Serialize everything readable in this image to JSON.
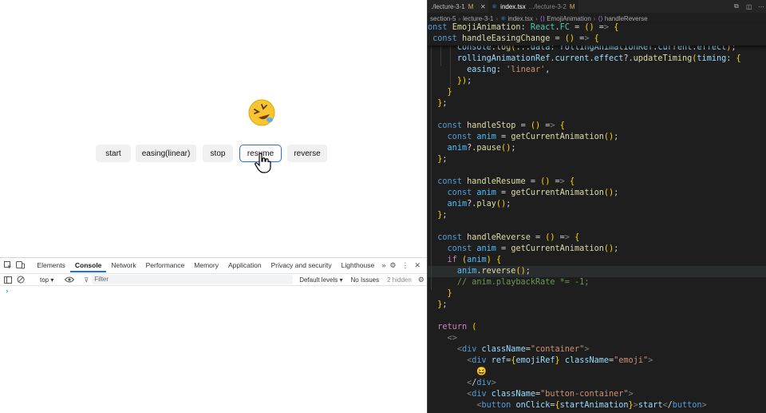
{
  "demo": {
    "buttons": [
      {
        "label": "start"
      },
      {
        "label": "easing(linear)"
      },
      {
        "label": "stop"
      },
      {
        "label": "resume",
        "active": true
      },
      {
        "label": "reverse"
      }
    ]
  },
  "devtools": {
    "tabs": [
      "Elements",
      "Console",
      "Network",
      "Performance",
      "Memory",
      "Application",
      "Privacy and security",
      "Lighthouse"
    ],
    "selected_tab": "Console",
    "context": "top",
    "filter_placeholder": "Filter",
    "levels": "Default levels",
    "issues": "No Issues",
    "hidden": "2 hidden",
    "prompt": "›"
  },
  "editor": {
    "tabs": [
      {
        "name": "./lecture-3-1",
        "status": "M"
      },
      {
        "name": "index.tsx",
        "path": ".../lecture-3-2",
        "status": "M"
      }
    ],
    "breadcrumb": [
      "section-5",
      "lecture-3-1",
      "index.tsx",
      "EmojiAnimation",
      "handleReverse"
    ],
    "sticky": [
      "onst EmojiAnimation: React.FC = () => {",
      " const handleEasingChange = () => {"
    ],
    "lines": [
      "      console.log(...data: rollingAnimationRef.current.effect);",
      "      rollingAnimationRef.current.effect?.updateTiming(timing: {",
      "        easing: 'linear',",
      "      });",
      "    }",
      "  };",
      "",
      "  const handleStop = () => {",
      "    const anim = getCurrentAnimation();",
      "    anim?.pause();",
      "  };",
      "",
      "  const handleResume = () => {",
      "    const anim = getCurrentAnimation();",
      "    anim?.play();",
      "  };",
      "",
      "  const handleReverse = () => {",
      "    const anim = getCurrentAnimation();",
      "    if (anim) {",
      "      anim.reverse();",
      "      // anim.playbackRate *= -1;",
      "    }",
      "  };",
      "",
      "  return (",
      "    <>",
      "      <div className=\"container\">",
      "        <div ref={emojiRef} className=\"emoji\">",
      "          😆",
      "        </div>",
      "        <div className=\"button-container\">",
      "          <button onClick={startAnimation}>start</button>"
    ]
  }
}
